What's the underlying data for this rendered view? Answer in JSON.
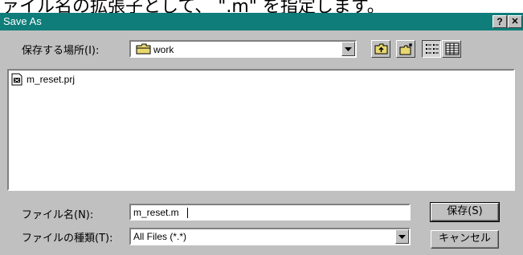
{
  "document": {
    "top_text": "ァイル名の拡張子として、 \".m\" を指定します。"
  },
  "window": {
    "title": "Save As",
    "help_glyph": "?",
    "close_glyph": "✕"
  },
  "save_in": {
    "label": "保存する場所(I):",
    "value": "work",
    "icon": "folder-icon"
  },
  "toolbar": {
    "up_icon": "up-one-level-icon",
    "new_folder_icon": "new-folder-icon",
    "list_icon": "list-view-icon",
    "details_icon": "details-view-icon"
  },
  "files": [
    {
      "name": "m_reset.prj",
      "icon": "project-file-icon"
    }
  ],
  "filename": {
    "label": "ファイル名(N):",
    "value": "m_reset.m"
  },
  "filetype": {
    "label": "ファイルの種類(T):",
    "value": "All Files (*.*)"
  },
  "buttons": {
    "save": "保存(S)",
    "cancel": "キャンセル"
  },
  "colors": {
    "titlebar": "#0f7d7a",
    "dialog_face": "#c0c0c0"
  }
}
